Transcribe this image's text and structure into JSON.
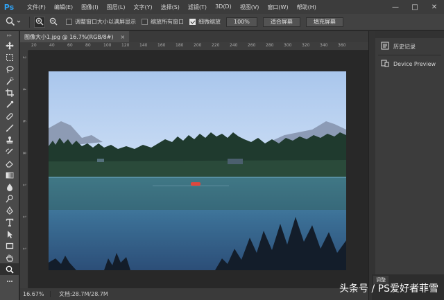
{
  "app": {
    "logo": "Ps"
  },
  "menu": [
    "文件(F)",
    "编辑(E)",
    "图像(I)",
    "图层(L)",
    "文字(Y)",
    "选择(S)",
    "滤镜(T)",
    "3D(D)",
    "视图(V)",
    "窗口(W)",
    "帮助(H)"
  ],
  "window_controls": {
    "minimize": "—",
    "maximize": "□",
    "close": "✕"
  },
  "options": {
    "resize_windows": {
      "label": "调整窗口大小以满屏显示",
      "checked": false
    },
    "zoom_all": {
      "label": "缩放所有窗口",
      "checked": false
    },
    "scrubby_zoom": {
      "label": "细微缩放",
      "checked": true
    },
    "zoom_value": "100%",
    "fit_screen": "适合屏幕",
    "fill_screen": "填充屏幕"
  },
  "document": {
    "tab_title": "图像大小1.jpg @ 16.7%(RGB/8#)",
    "tab_close": "×"
  },
  "ruler": {
    "h_ticks": [
      "20",
      "40",
      "60",
      "80",
      "100",
      "120",
      "140",
      "160",
      "180",
      "200",
      "220",
      "240",
      "260",
      "280",
      "300",
      "320",
      "340",
      "360"
    ],
    "v_ticks": [
      "2",
      "4",
      "6",
      "8",
      "1",
      "1",
      "1"
    ]
  },
  "status": {
    "zoom": "16.67%",
    "doc": "文档:28.7M/28.7M"
  },
  "panels": {
    "history": "历史记录",
    "device_preview": "Device Preview",
    "adjust_tab": "调整"
  },
  "watermark": "头条号 / PS爱好者菲雪",
  "colors": {
    "accent": "#2fa3f5",
    "bg": "#282828"
  }
}
